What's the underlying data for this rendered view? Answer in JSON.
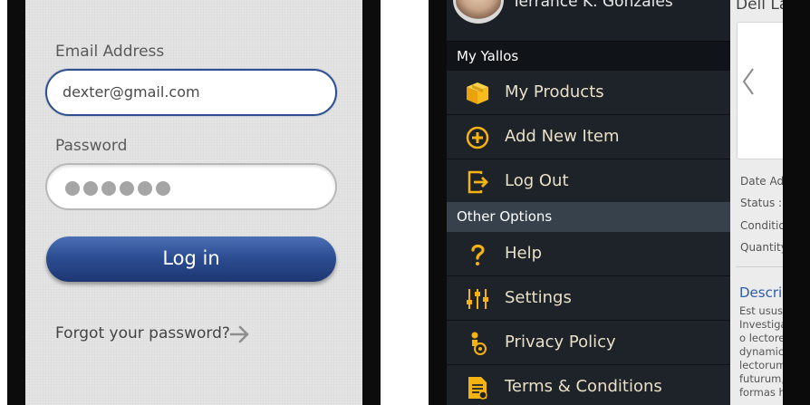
{
  "login": {
    "email_label": "Email Address",
    "email_value": "dexter@gmail.com",
    "password_label": "Password",
    "password_mask": "●●●●●●",
    "login_button": "Log in",
    "forgot_link": "Forgot your password?",
    "forgot_icon": "arrow-right-icon"
  },
  "drawer": {
    "user_name": "Terrance K. Gonzales",
    "section_my": "My Yallos",
    "section_other": "Other Options",
    "items": [
      {
        "label": "My Products",
        "icon": "box-icon"
      },
      {
        "label": "Add New Item",
        "icon": "plus-circle-icon"
      },
      {
        "label": "Log Out",
        "icon": "logout-icon"
      },
      {
        "label": "Help",
        "icon": "question-icon"
      },
      {
        "label": "Settings",
        "icon": "sliders-icon"
      },
      {
        "label": "Privacy Policy",
        "icon": "privacy-icon"
      },
      {
        "label": "Terms & Conditions",
        "icon": "document-icon"
      }
    ],
    "accent_color": "#f5b312"
  },
  "content": {
    "title": "Dell La",
    "meta": [
      "Date Ad",
      "Status :",
      "Conditio",
      "Quantity"
    ],
    "description_heading": "Descri",
    "description_lines": [
      "Est usus",
      "Investiga",
      "o lectore",
      "dynamic",
      "lectorum",
      "futurum,",
      "formas h"
    ]
  }
}
